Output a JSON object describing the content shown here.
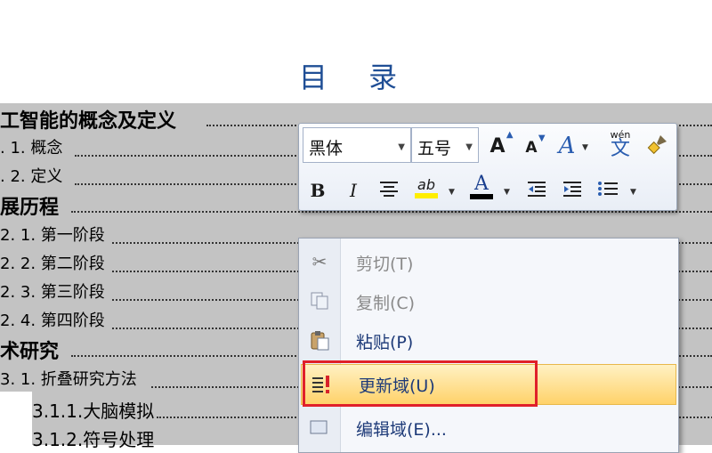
{
  "document": {
    "title": "目 录",
    "toc": [
      {
        "text": "工智能的概念及定义",
        "level": 1
      },
      {
        "text": ". 1. 概念",
        "level": 2
      },
      {
        "text": ". 2. 定义",
        "level": 2
      },
      {
        "text": "展历程",
        "level": 1
      },
      {
        "text": "2. 1. 第一阶段",
        "level": 2
      },
      {
        "text": "2. 2. 第二阶段",
        "level": 2
      },
      {
        "text": "2. 3. 第三阶段",
        "level": 2
      },
      {
        "text": "2. 4. 第四阶段",
        "level": 2
      },
      {
        "text": "术研究",
        "level": 1
      },
      {
        "text": "3. 1. 折叠研究方法",
        "level": 2
      },
      {
        "text": "3.1.1.大脑模拟",
        "level": 3
      },
      {
        "text": "3.1.2.符号处理",
        "level": 3
      }
    ]
  },
  "minibar": {
    "font": "黑体",
    "size": "五号",
    "grow_icon": "A",
    "shrink_icon": "A",
    "style_icon": "A",
    "phonetic_top": "wén",
    "phonetic_char": "文",
    "bold": "B",
    "italic": "I",
    "font_color_letter": "A",
    "highlight_text": "ab"
  },
  "context_menu": {
    "items": [
      {
        "label": "剪切(T)",
        "icon": "scissors-icon",
        "enabled": false
      },
      {
        "label": "复制(C)",
        "icon": "copy-icon",
        "enabled": false
      },
      {
        "label": "粘贴(P)",
        "icon": "paste-icon",
        "enabled": true
      },
      {
        "label": "更新域(U)",
        "icon": "update-field-icon",
        "enabled": true
      },
      {
        "label": "编辑域(E)...",
        "icon": "edit-field-icon",
        "enabled": true
      }
    ]
  },
  "colors": {
    "title": "#1f4e95",
    "selection": "#c3c3c3",
    "menu_highlight": "#ffd26a",
    "annotation_box": "#e0202a",
    "font_color_bar": "#000000",
    "highlight_bar": "#ffee00"
  }
}
